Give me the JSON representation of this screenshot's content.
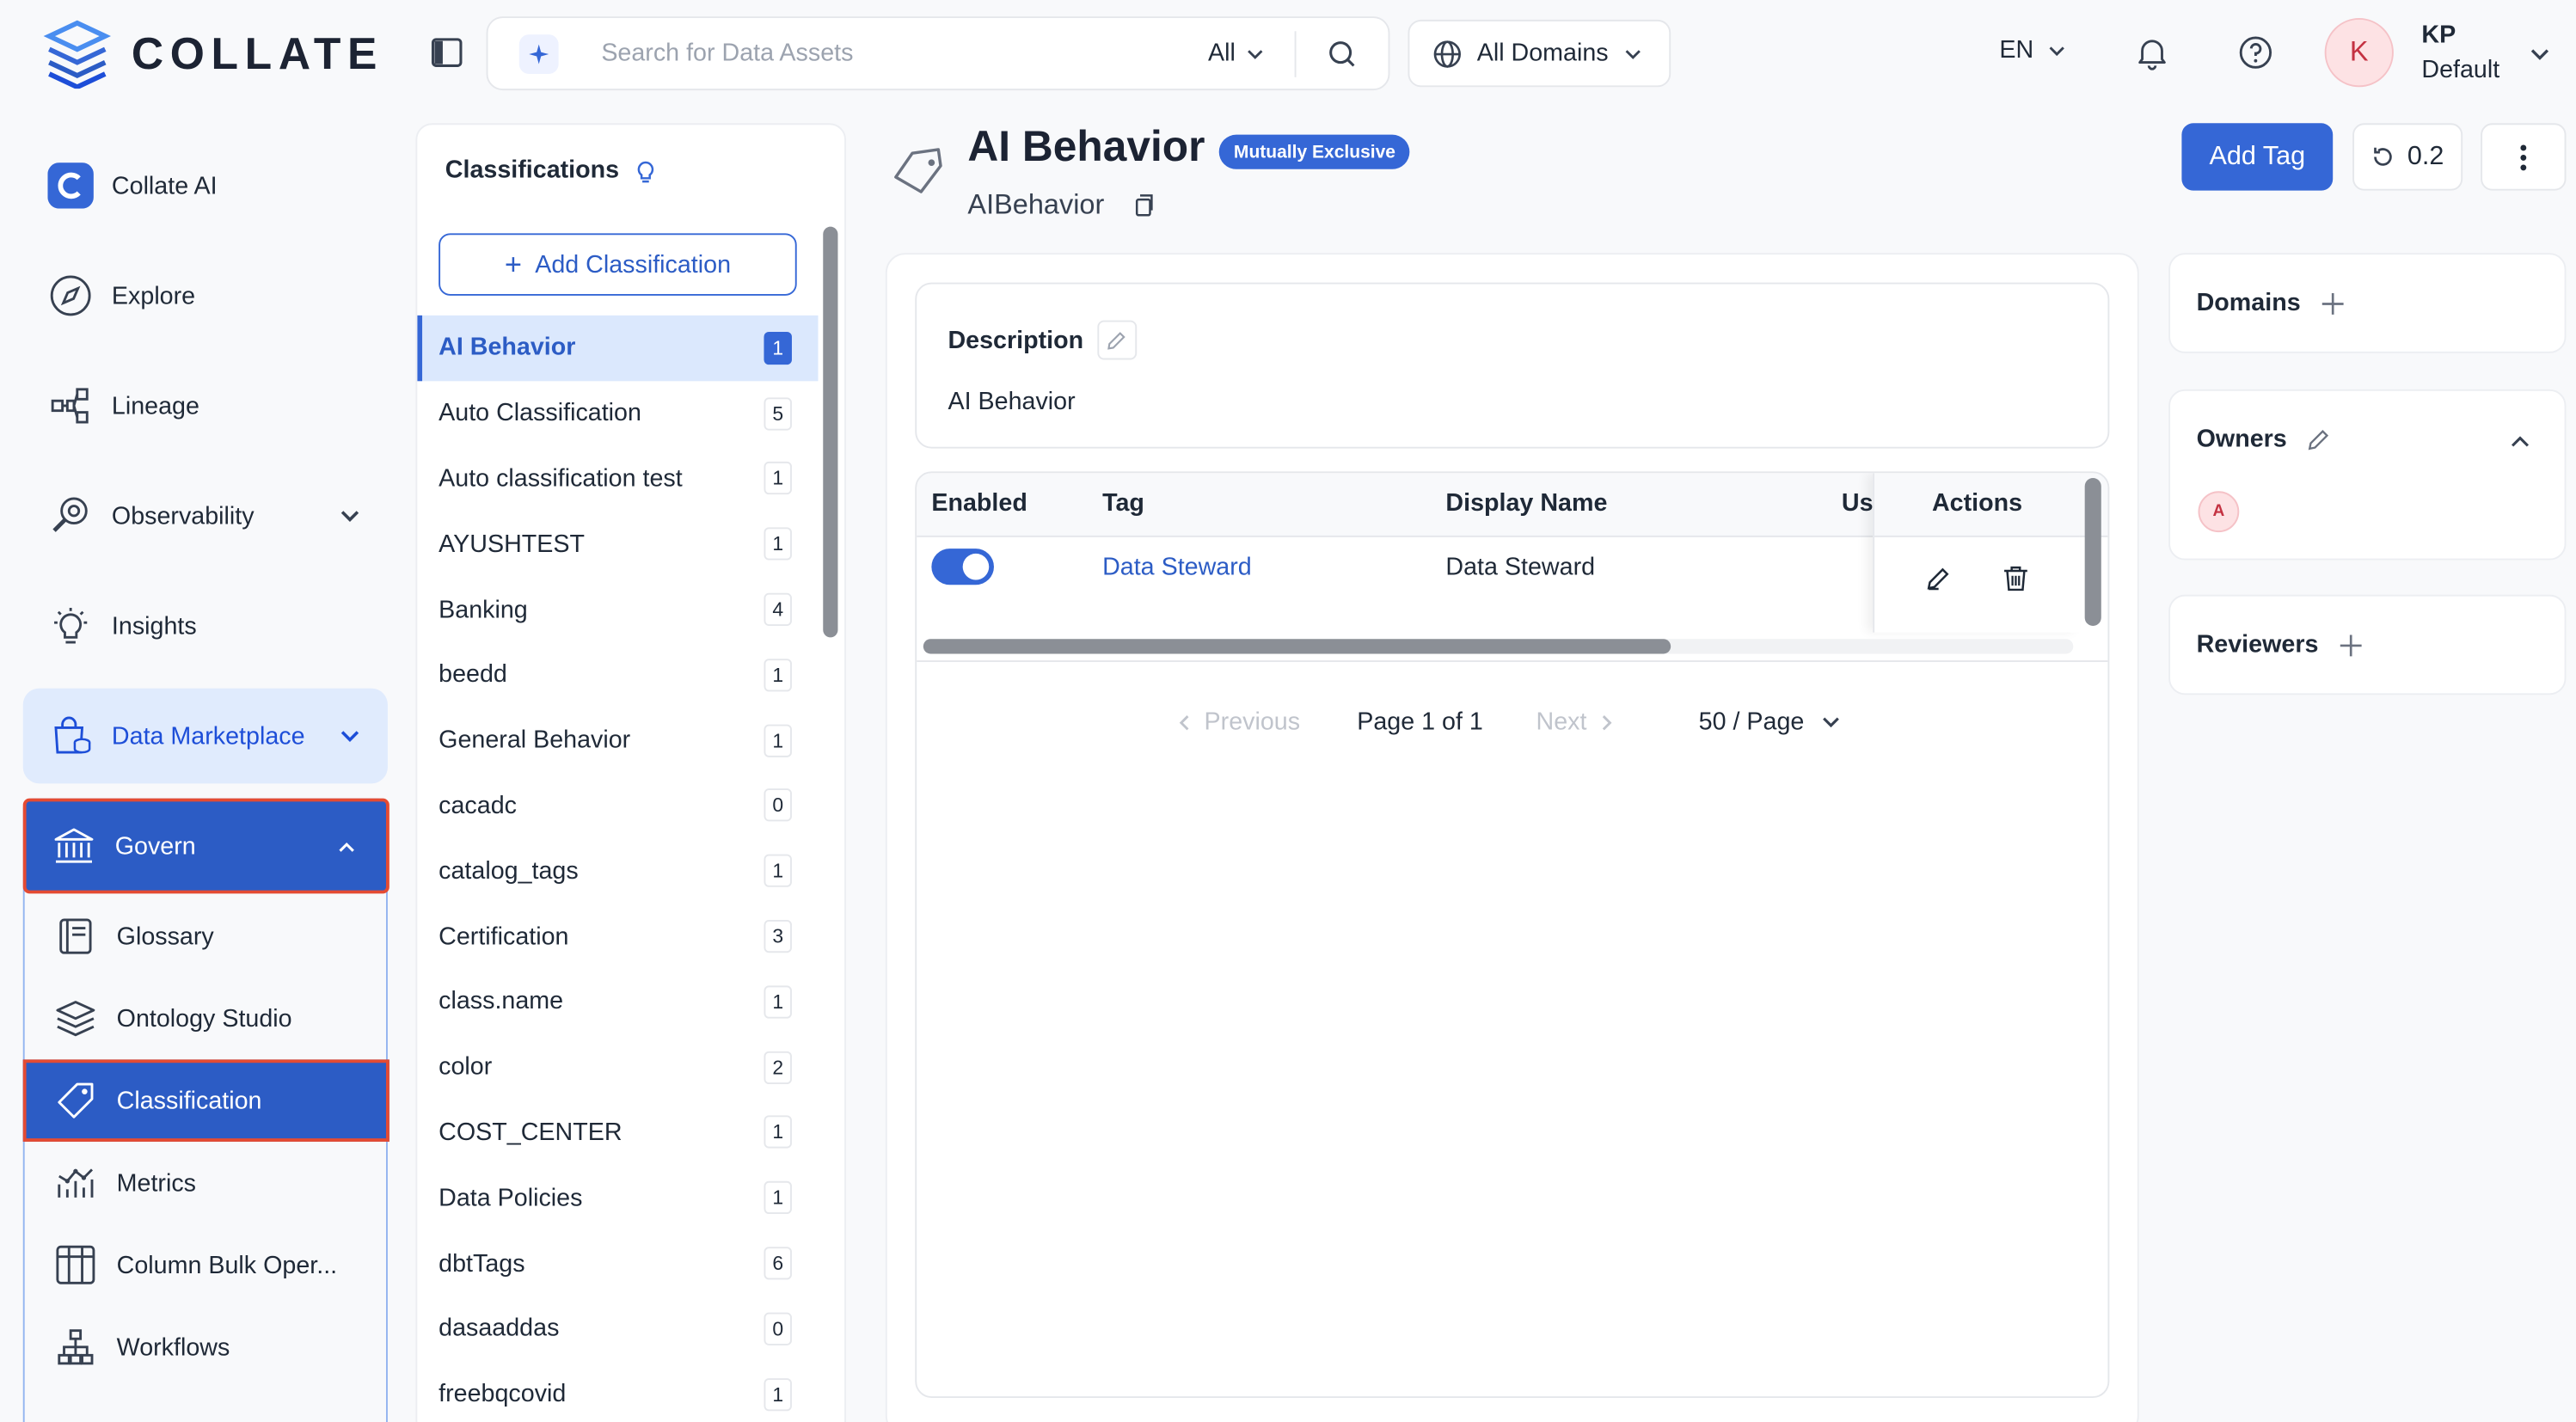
{
  "brand": {
    "name": "COLLATE",
    "accent": "#3567d6"
  },
  "search": {
    "placeholder": "Search for Data Assets",
    "scope": "All"
  },
  "domain_selector": {
    "label": "All Domains"
  },
  "header": {
    "language": "EN",
    "user": {
      "initial": "K",
      "name": "KP",
      "role": "Default"
    }
  },
  "nav": {
    "items": [
      {
        "label": "Collate AI"
      },
      {
        "label": "Explore"
      },
      {
        "label": "Lineage"
      },
      {
        "label": "Observability"
      },
      {
        "label": "Insights"
      },
      {
        "label": "Data Marketplace"
      }
    ],
    "govern": {
      "label": "Govern",
      "children": [
        {
          "label": "Glossary"
        },
        {
          "label": "Ontology Studio"
        },
        {
          "label": "Classification"
        },
        {
          "label": "Metrics"
        },
        {
          "label": "Column Bulk Oper..."
        },
        {
          "label": "Workflows"
        }
      ]
    }
  },
  "classifications": {
    "title": "Classifications",
    "add_label": "Add Classification",
    "items": [
      {
        "name": "AI Behavior",
        "count": "1",
        "active": true
      },
      {
        "name": "Auto Classification",
        "count": "5"
      },
      {
        "name": "Auto classification test",
        "count": "1"
      },
      {
        "name": "AYUSHTEST",
        "count": "1"
      },
      {
        "name": "Banking",
        "count": "4"
      },
      {
        "name": "beedd",
        "count": "1"
      },
      {
        "name": "General Behavior",
        "count": "1"
      },
      {
        "name": "cacadc",
        "count": "0"
      },
      {
        "name": "catalog_tags",
        "count": "1"
      },
      {
        "name": "Certification",
        "count": "3"
      },
      {
        "name": "class.name",
        "count": "1"
      },
      {
        "name": "color",
        "count": "2"
      },
      {
        "name": "COST_CENTER",
        "count": "1"
      },
      {
        "name": "Data Policies",
        "count": "1"
      },
      {
        "name": "dbtTags",
        "count": "6"
      },
      {
        "name": "dasaaddas",
        "count": "0"
      },
      {
        "name": "freebqcovid",
        "count": "1"
      }
    ]
  },
  "page": {
    "title": "AI Behavior",
    "badge": "Mutually Exclusive",
    "fqn": "AIBehavior",
    "add_tag_label": "Add Tag",
    "version": "0.2"
  },
  "description": {
    "label": "Description",
    "text": "AI Behavior"
  },
  "tags_table": {
    "columns": {
      "enabled": "Enabled",
      "tag": "Tag",
      "display_name": "Display Name",
      "usage": "Us",
      "actions": "Actions"
    },
    "rows": [
      {
        "enabled": true,
        "tag": "Data Steward",
        "display_name": "Data Steward"
      }
    ],
    "pagination": {
      "previous": "Previous",
      "page": "Page 1 of 1",
      "next": "Next",
      "page_size": "50 / Page"
    }
  },
  "side": {
    "domains": "Domains",
    "owners": "Owners",
    "owner_initial": "A",
    "reviewers": "Reviewers"
  }
}
